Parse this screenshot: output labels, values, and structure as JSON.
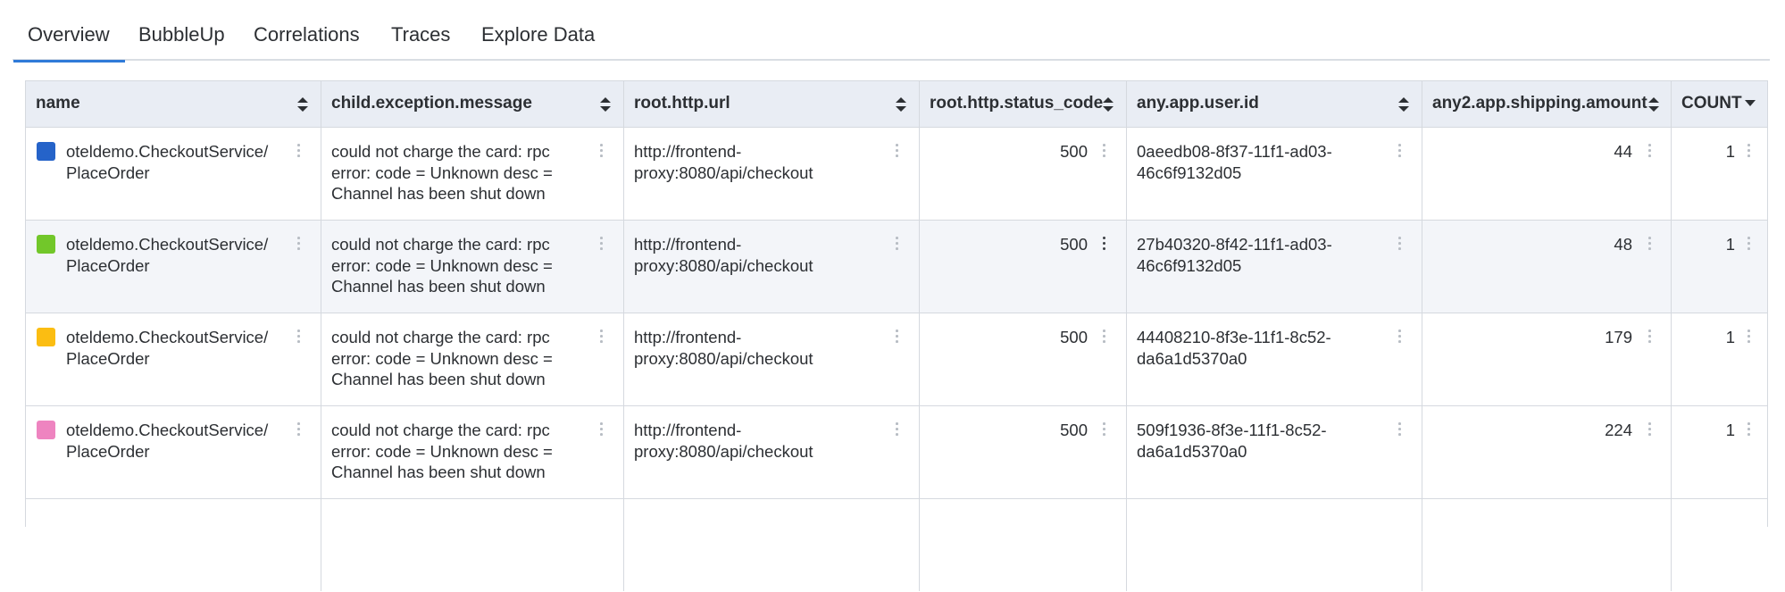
{
  "tabs": [
    {
      "label": "Overview",
      "active": true
    },
    {
      "label": "BubbleUp",
      "active": false
    },
    {
      "label": "Correlations",
      "active": false
    },
    {
      "label": "Traces",
      "active": false
    },
    {
      "label": "Explore Data",
      "active": false
    }
  ],
  "columns": [
    {
      "label": "name",
      "sort": "both"
    },
    {
      "label": "child.exception.message",
      "sort": "both"
    },
    {
      "label": "root.http.url",
      "sort": "both"
    },
    {
      "label": "root.http.status_code",
      "sort": "both"
    },
    {
      "label": "any.app.user.id",
      "sort": "both"
    },
    {
      "label": "any2.app.shipping.amount",
      "sort": "both"
    },
    {
      "label": "COUNT",
      "sort": "desc"
    }
  ],
  "rows": [
    {
      "color": "#2563c9",
      "name_line1": "oteldemo.CheckoutService/",
      "name_line2": "PlaceOrder",
      "msg_line1": "could not charge the card: rpc",
      "msg_line2": "error: code = Unknown desc =",
      "msg_line3": "Channel has been shut down",
      "url_line1": "http://frontend-",
      "url_line2": "proxy:8080/api/checkout",
      "status_code": "500",
      "user_id_line1": "0aeedb08-8f37-11f1-ad03-",
      "user_id_line2": "46c6f9132d05",
      "shipping": "44",
      "count": "1"
    },
    {
      "color": "#72c72a",
      "name_line1": "oteldemo.CheckoutService/",
      "name_line2": "PlaceOrder",
      "msg_line1": "could not charge the card: rpc",
      "msg_line2": "error: code = Unknown desc =",
      "msg_line3": "Channel has been shut down",
      "url_line1": "http://frontend-",
      "url_line2": "proxy:8080/api/checkout",
      "status_code": "500",
      "user_id_line1": "27b40320-8f42-11f1-ad03-",
      "user_id_line2": "46c6f9132d05",
      "shipping": "48",
      "count": "1"
    },
    {
      "color": "#fbbd12",
      "name_line1": "oteldemo.CheckoutService/",
      "name_line2": "PlaceOrder",
      "msg_line1": "could not charge the card: rpc",
      "msg_line2": "error: code = Unknown desc =",
      "msg_line3": "Channel has been shut down",
      "url_line1": "http://frontend-",
      "url_line2": "proxy:8080/api/checkout",
      "status_code": "500",
      "user_id_line1": "44408210-8f3e-11f1-8c52-",
      "user_id_line2": "da6a1d5370a0",
      "shipping": "179",
      "count": "1"
    },
    {
      "color": "#ee84c0",
      "name_line1": "oteldemo.CheckoutService/",
      "name_line2": "PlaceOrder",
      "msg_line1": "could not charge the card: rpc",
      "msg_line2": "error: code = Unknown desc =",
      "msg_line3": "Channel has been shut down",
      "url_line1": "http://frontend-",
      "url_line2": "proxy:8080/api/checkout",
      "status_code": "500",
      "user_id_line1": "509f1936-8f3e-11f1-8c52-",
      "user_id_line2": "da6a1d5370a0",
      "shipping": "224",
      "count": "1"
    }
  ]
}
